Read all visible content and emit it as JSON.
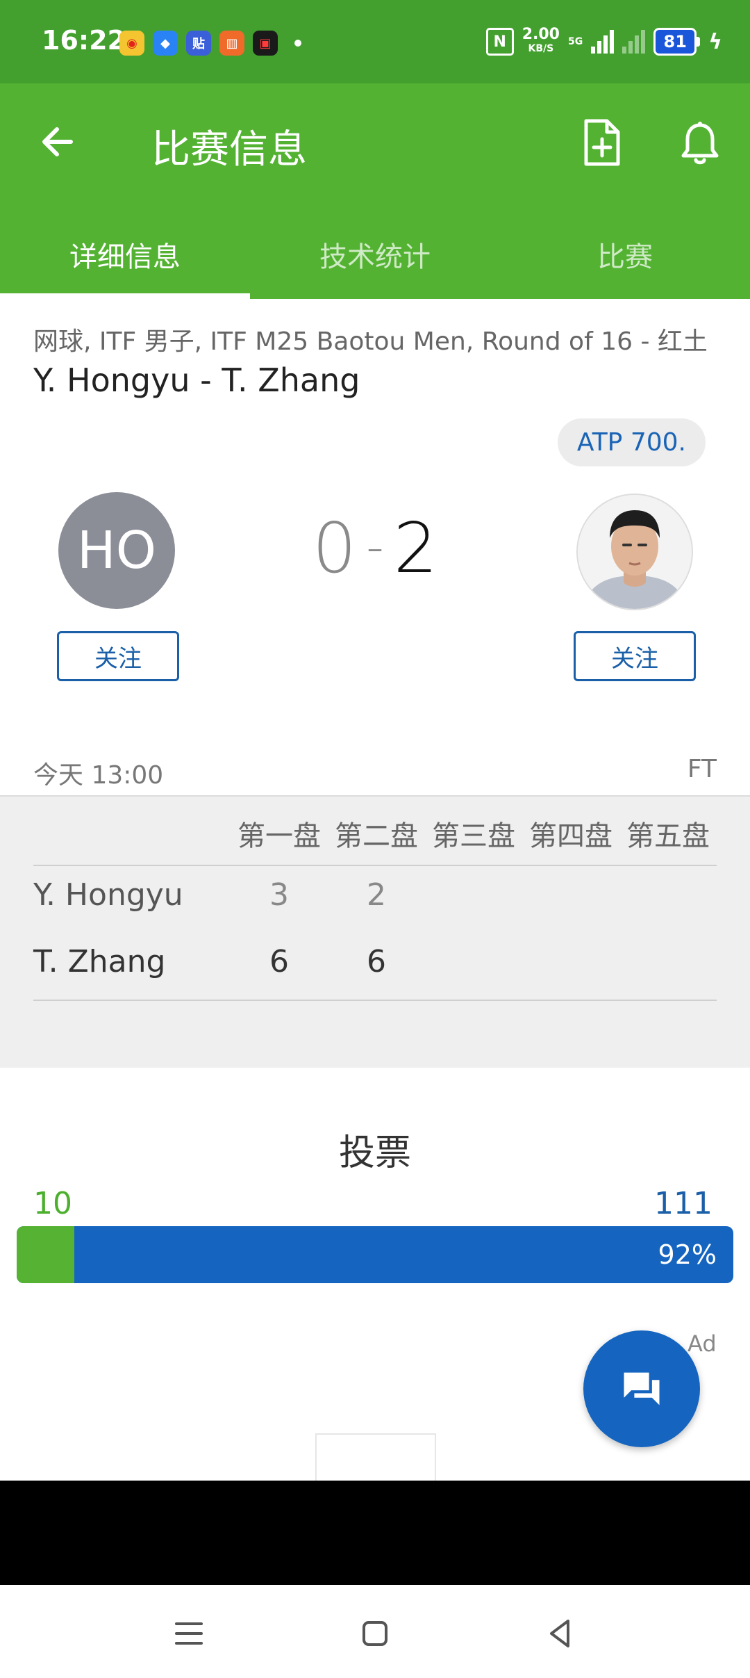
{
  "status_bar": {
    "time": "16:22",
    "net_speed": "2.00",
    "net_unit": "KB/S",
    "network": "5G",
    "battery": "81",
    "icons": [
      "weibo-icon",
      "browser-icon",
      "tieba-icon",
      "books-icon",
      "video-icon",
      "nfc-icon",
      "signal-icon",
      "battery-icon",
      "charging-icon"
    ]
  },
  "header": {
    "title": "比赛信息",
    "icons": [
      "back-arrow-icon",
      "add-file-icon",
      "bell-icon"
    ]
  },
  "tabs": [
    {
      "label": "详细信息",
      "active": true
    },
    {
      "label": "技术统计",
      "active": false
    },
    {
      "label": "比赛",
      "active": false
    }
  ],
  "match": {
    "subtitle": "网球, ITF 男子, ITF M25 Baotou Men, Round of 16 - 红土",
    "title": "Y. Hongyu - T. Zhang",
    "badge": "ATP 700.",
    "home_initials": "HO",
    "home_sets": "0",
    "separator": "-",
    "away_sets": "2",
    "follow_label": "关注",
    "date": "今天 13:00",
    "status": "FT"
  },
  "sets_table": {
    "headers": [
      "第一盘",
      "第二盘",
      "第三盘",
      "第四盘",
      "第五盘"
    ],
    "rows": [
      {
        "name": "Y. Hongyu",
        "scores": [
          "3",
          "2"
        ]
      },
      {
        "name": "T. Zhang",
        "scores": [
          "6",
          "6"
        ]
      }
    ]
  },
  "vote": {
    "title": "投票",
    "home_votes": "10",
    "away_votes": "111",
    "away_percent_label": "92%",
    "home_fraction": 0.08
  },
  "ad": {
    "label": "Ad"
  },
  "colors": {
    "status_green": "#43a02f",
    "header_green": "#53b232",
    "brand_blue": "#1565c0",
    "vote_green": "#55b233"
  },
  "fab": {
    "icon": "chat-icon"
  }
}
